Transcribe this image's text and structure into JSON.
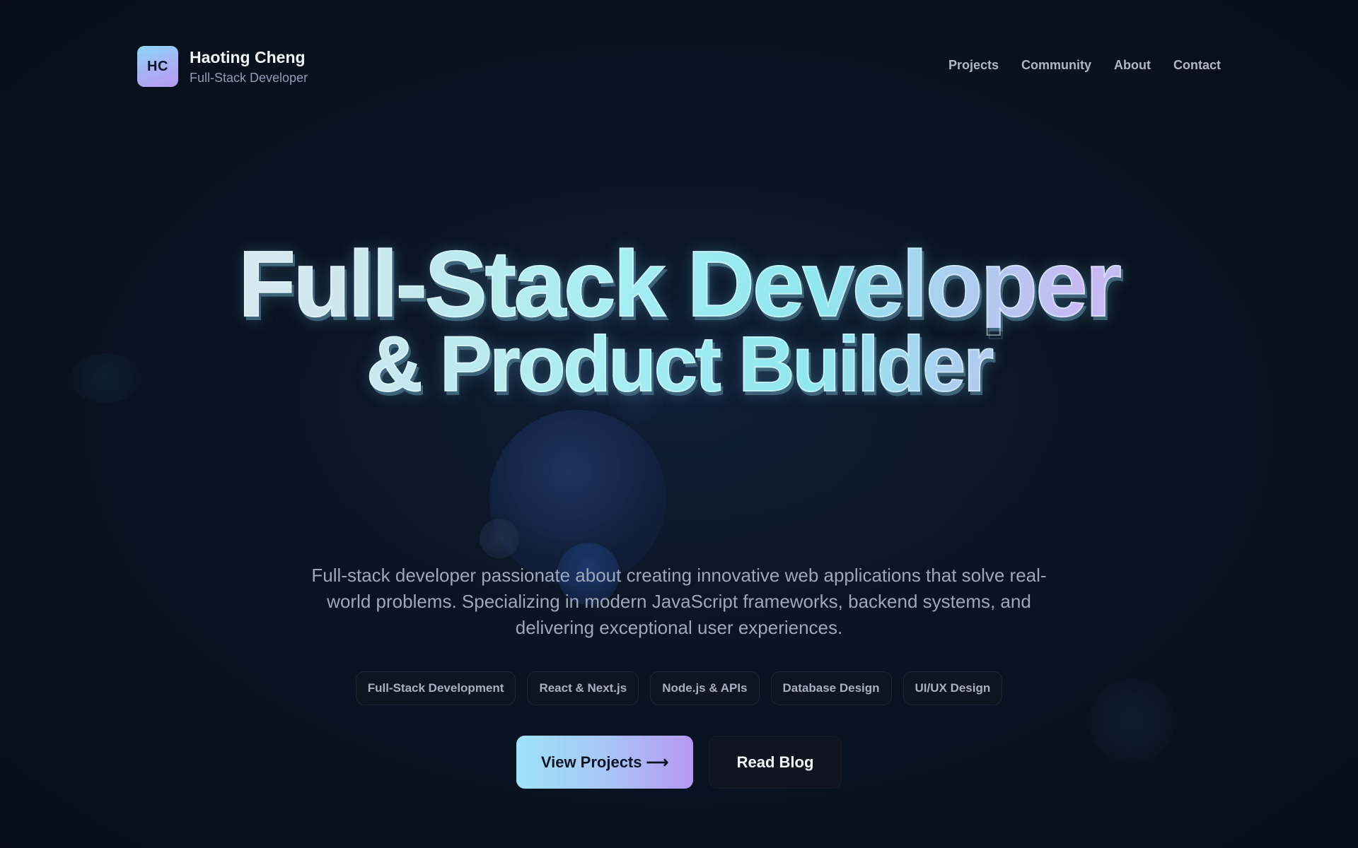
{
  "header": {
    "logo_initials": "HC",
    "name": "Haoting Cheng",
    "role": "Full-Stack Developer"
  },
  "nav": {
    "items": [
      "Projects",
      "Community",
      "About",
      "Contact"
    ]
  },
  "hero": {
    "title_line_1": "Full-Stack Developer",
    "title_line_2": "& Product Builder",
    "description": "Full-stack developer passionate about creating innovative web applications that solve real-world problems. Specializing in modern JavaScript frameworks, backend systems, and delivering exceptional user experiences.",
    "tags": [
      "Full-Stack Development",
      "React & Next.js",
      "Node.js & APIs",
      "Database Design",
      "UI/UX Design"
    ],
    "primary_button": "View Projects ⟶",
    "secondary_button": "Read Blog"
  },
  "colors": {
    "background": "#091220",
    "accent_cyan": "#9fe2f8",
    "accent_purple": "#b698f1",
    "text_muted": "#9ca8ba"
  }
}
